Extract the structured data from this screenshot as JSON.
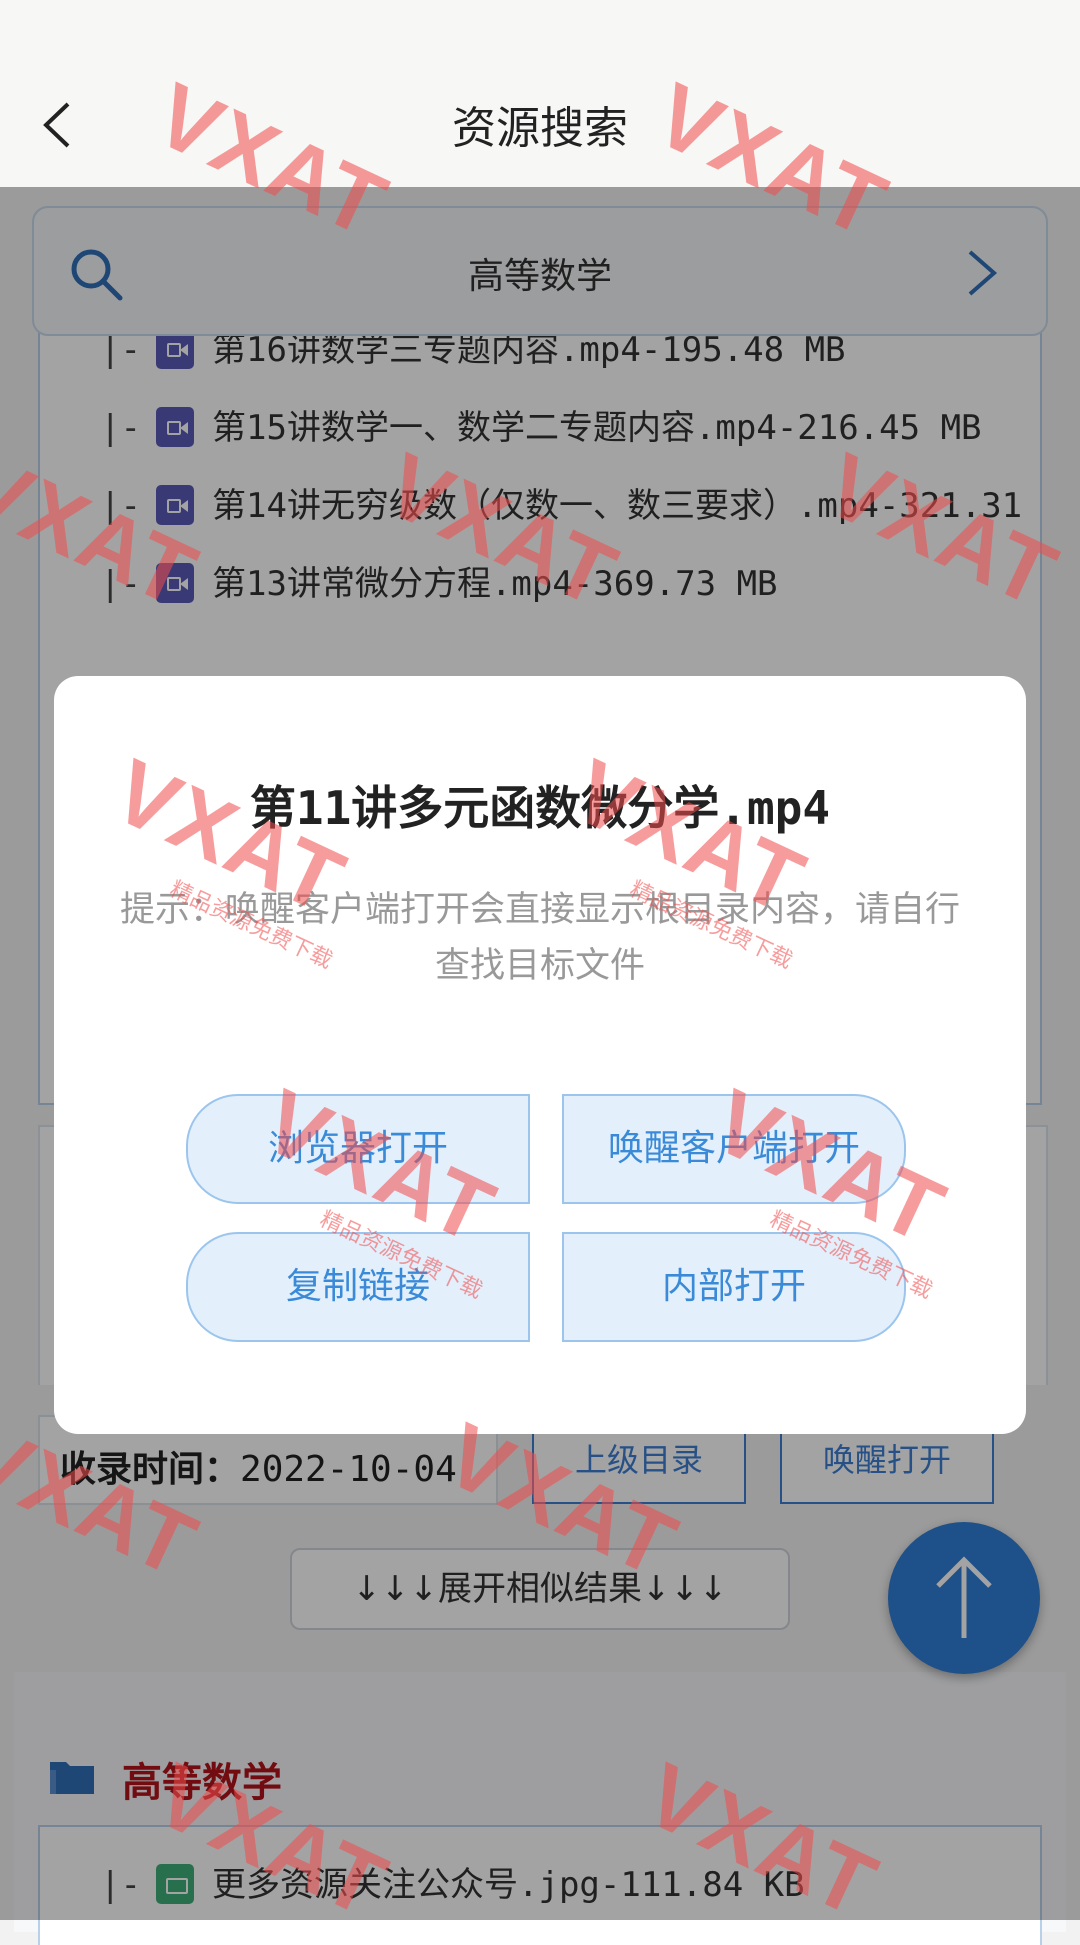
{
  "header": {
    "title": "资源搜索",
    "back_icon": "chevron-left-icon"
  },
  "search": {
    "value": "高等数学",
    "icon": "search-icon",
    "go_icon": "chevron-right-icon"
  },
  "file_list": {
    "prefix": "|-",
    "rows": [
      {
        "name": "第16讲数学三专题内容.mp4-195.48 MB",
        "type": "video"
      },
      {
        "name": "第15讲数学一、数学二专题内容.mp4-216.45 MB",
        "type": "video"
      },
      {
        "name": "第14讲无穷级数（仅数一、数三要求）.mp4-321.31",
        "type": "video"
      },
      {
        "name": "第13讲常微分方程.mp4-369.73 MB",
        "type": "video"
      }
    ]
  },
  "meta": {
    "record_label": "收录时间：",
    "record_value": "2022-10-04",
    "parent_dir": "上级目录",
    "wake_open": "唤醒打开",
    "expand": "↓↓↓展开相似结果↓↓↓"
  },
  "result2": {
    "folder_title": "高等数学",
    "rows": [
      {
        "name": "更多资源关注公众号.jpg-111.84 KB",
        "type": "image"
      }
    ]
  },
  "dialog": {
    "title": "第11讲多元函数微分学.mp4",
    "hint": "提示：唤醒客户端打开会直接显示根目录内容，请自行查找目标文件",
    "buttons": {
      "browser": "浏览器打开",
      "wake_client": "唤醒客户端打开",
      "copy_link": "复制链接",
      "internal": "内部打开"
    }
  },
  "watermark": {
    "mark": "VXAT",
    "sub": "精品资源免费下载"
  },
  "colors": {
    "accent": "#2f7dd6",
    "folder_title": "#b3141b",
    "dialog_button_bg": "#e3f0fc"
  }
}
